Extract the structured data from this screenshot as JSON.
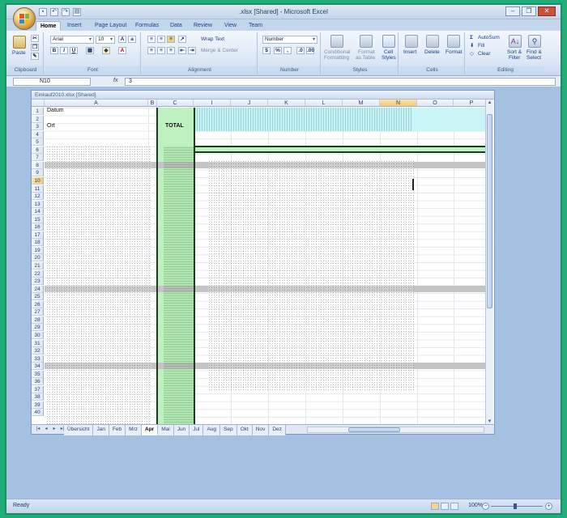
{
  "window": {
    "title": ".xlsx  [Shared]  -  Microsoft Excel",
    "controls": {
      "minimize": "–",
      "restore": "❐",
      "close": "✕"
    }
  },
  "quick_access": [
    "save-icon",
    "undo-icon",
    "redo-icon",
    "print-preview-icon"
  ],
  "ribbon": {
    "tabs": [
      "Home",
      "Insert",
      "Page Layout",
      "Formulas",
      "Data",
      "Review",
      "View",
      "Team"
    ],
    "active_tab": "Home",
    "clipboard": {
      "label": "Clipboard",
      "paste": "Paste"
    },
    "font": {
      "label": "Font",
      "name": "Arial",
      "size": "10",
      "bold": "B",
      "italic": "I",
      "underline": "U"
    },
    "alignment": {
      "label": "Alignment",
      "wrap": "Wrap Text",
      "merge": "Merge & Center"
    },
    "number": {
      "label": "Number",
      "format": "Number",
      "percent": "%",
      "comma": ","
    },
    "styles": {
      "label": "Styles",
      "conditional": "Conditional",
      "conditional2": "Formatting",
      "format_table": "Format",
      "format_table2": "as Table",
      "cell_styles": "Cell",
      "cell_styles2": "Styles"
    },
    "cells": {
      "label": "Cells",
      "insert": "Insert",
      "delete": "Delete",
      "format": "Format"
    },
    "editing": {
      "label": "Editing",
      "autosum": "AutoSum",
      "fill": "Fill",
      "clear": "Clear",
      "sort": "Sort &",
      "sort2": "Filter",
      "find": "Find &",
      "find2": "Select"
    }
  },
  "formula_bar": {
    "name_box": "N10",
    "fx": "fx",
    "value": "3"
  },
  "document": {
    "title": "Einkauf2010.xlsx  [Shared]",
    "columns": [
      "A",
      "B",
      "C",
      "I",
      "J",
      "K",
      "L",
      "M",
      "N",
      "O",
      "P"
    ],
    "selected_column": "N",
    "rows": [
      "1",
      "2",
      "3",
      "4",
      "5",
      "6",
      "7",
      "8",
      "9",
      "10",
      "11",
      "12",
      "13",
      "14",
      "15",
      "16",
      "17",
      "18",
      "19",
      "20",
      "21",
      "22",
      "23",
      "24",
      "25",
      "26",
      "27",
      "28",
      "29",
      "30",
      "31",
      "32",
      "33",
      "34",
      "35",
      "36",
      "37",
      "38",
      "39",
      "40"
    ],
    "selected_row": "10",
    "cells": {
      "A1": "Datum",
      "A2": "Ort",
      "C2": "TOTAL"
    },
    "sheet_tabs": [
      "Übersicht",
      "Jan",
      "Feb",
      "Mrz",
      "Apr",
      "Mai",
      "Jun",
      "Jul",
      "Aug",
      "Sep",
      "Okt",
      "Nov",
      "Dez"
    ],
    "active_sheet": "Apr"
  },
  "status": {
    "ready": "Ready",
    "zoom": "100%"
  }
}
